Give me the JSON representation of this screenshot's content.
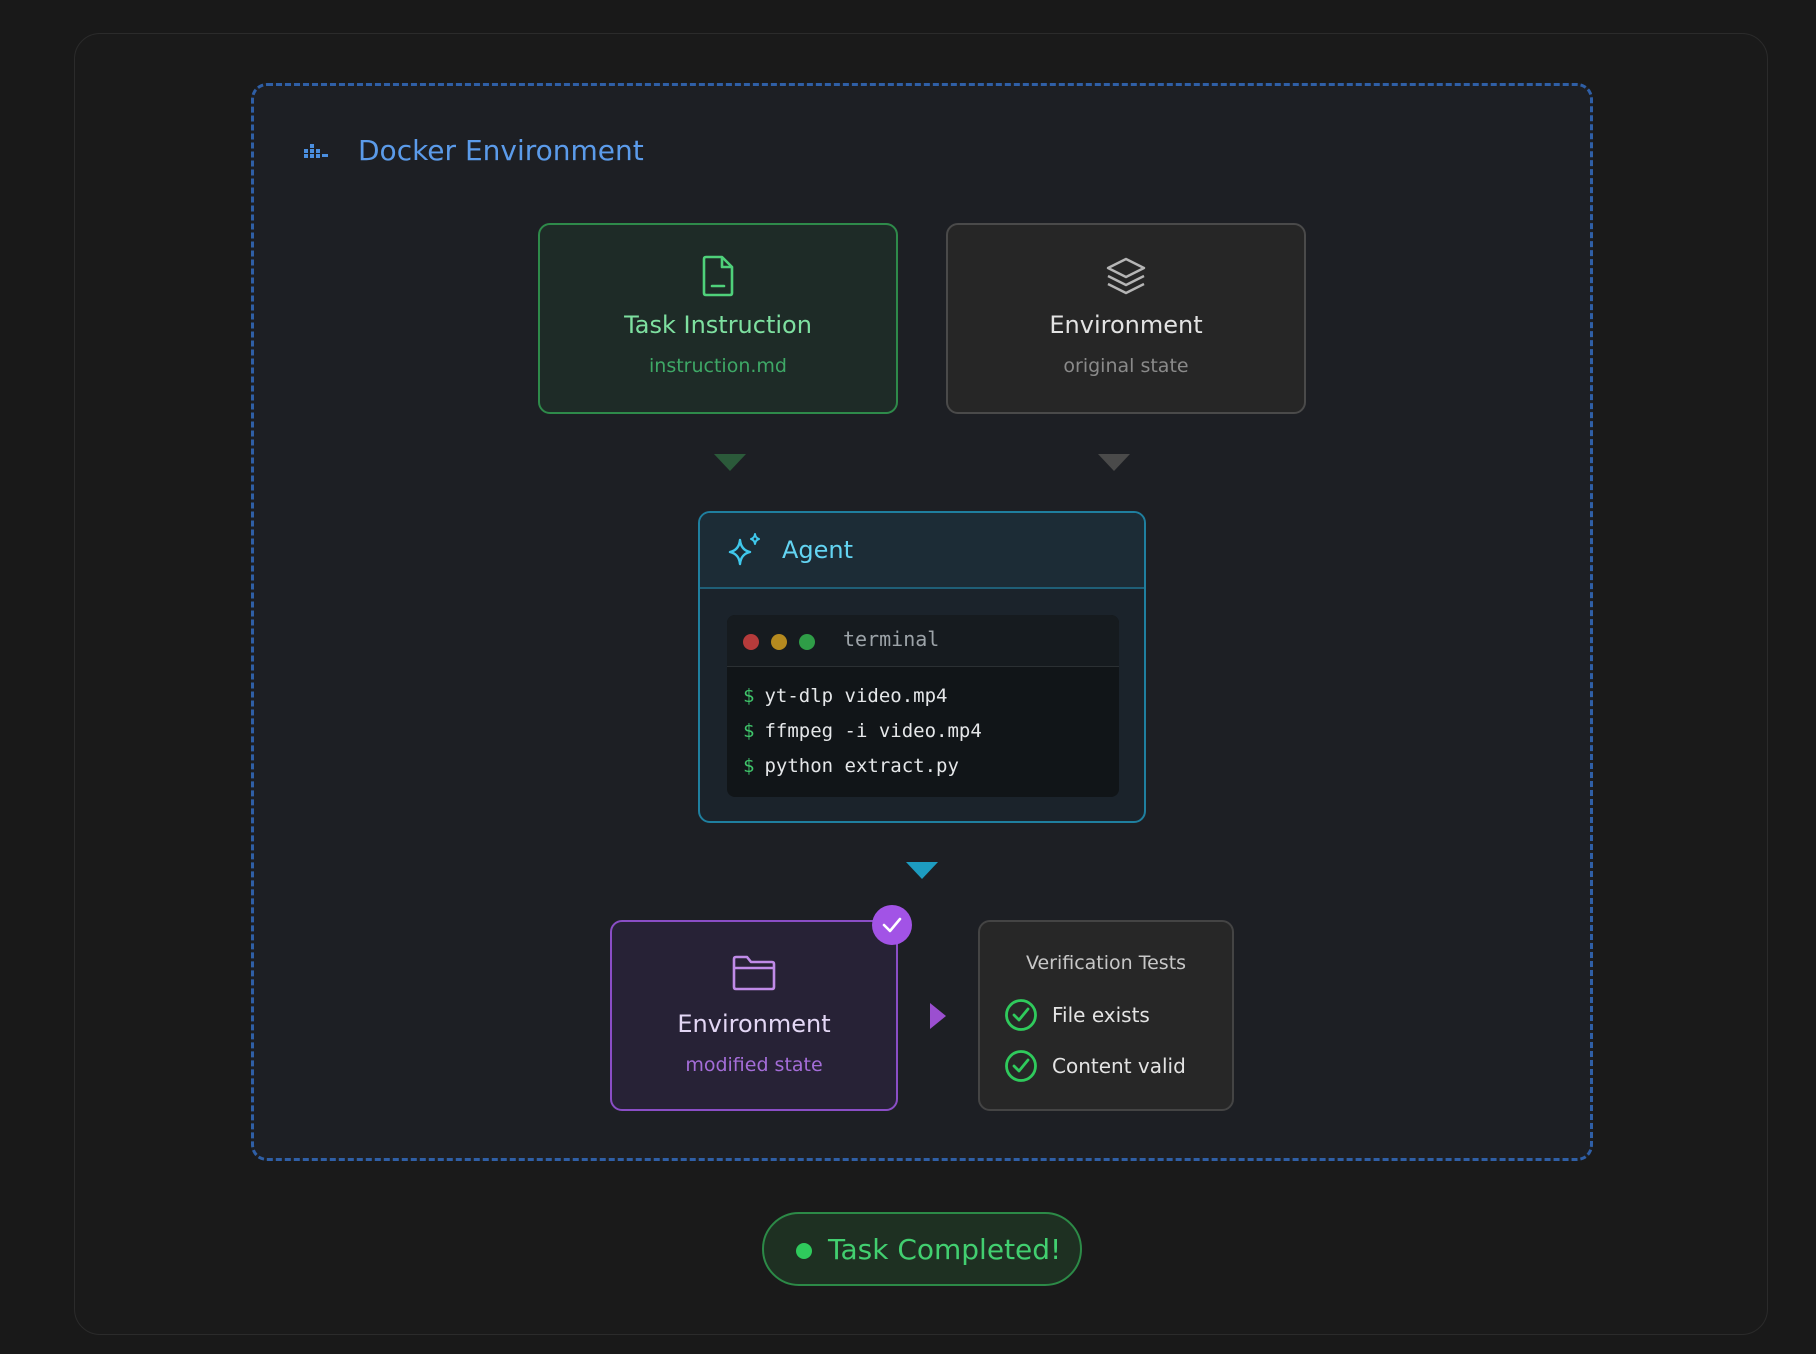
{
  "docker": {
    "title": "Docker Environment",
    "icon": "docker-icon",
    "border_color": "#2f5fa6"
  },
  "task_instruction": {
    "title": "Task Instruction",
    "subtitle": "instruction.md",
    "icon": "document-icon",
    "color": "#2e8a4a"
  },
  "environment_original": {
    "title": "Environment",
    "subtitle": "original state",
    "icon": "layers-icon"
  },
  "agent": {
    "title": "Agent",
    "icon": "sparkles-icon",
    "terminal": {
      "title": "terminal",
      "prompt": "$",
      "commands": [
        "yt-dlp video.mp4",
        "ffmpeg -i video.mp4",
        "python extract.py"
      ]
    }
  },
  "environment_modified": {
    "title": "Environment",
    "subtitle": "modified state",
    "icon": "folder-icon",
    "color": "#8a4ec6"
  },
  "verification": {
    "title": "Verification Tests",
    "checks": [
      "File exists",
      "Content valid"
    ]
  },
  "status": {
    "label": "Task Completed!",
    "color": "#42cf70"
  }
}
